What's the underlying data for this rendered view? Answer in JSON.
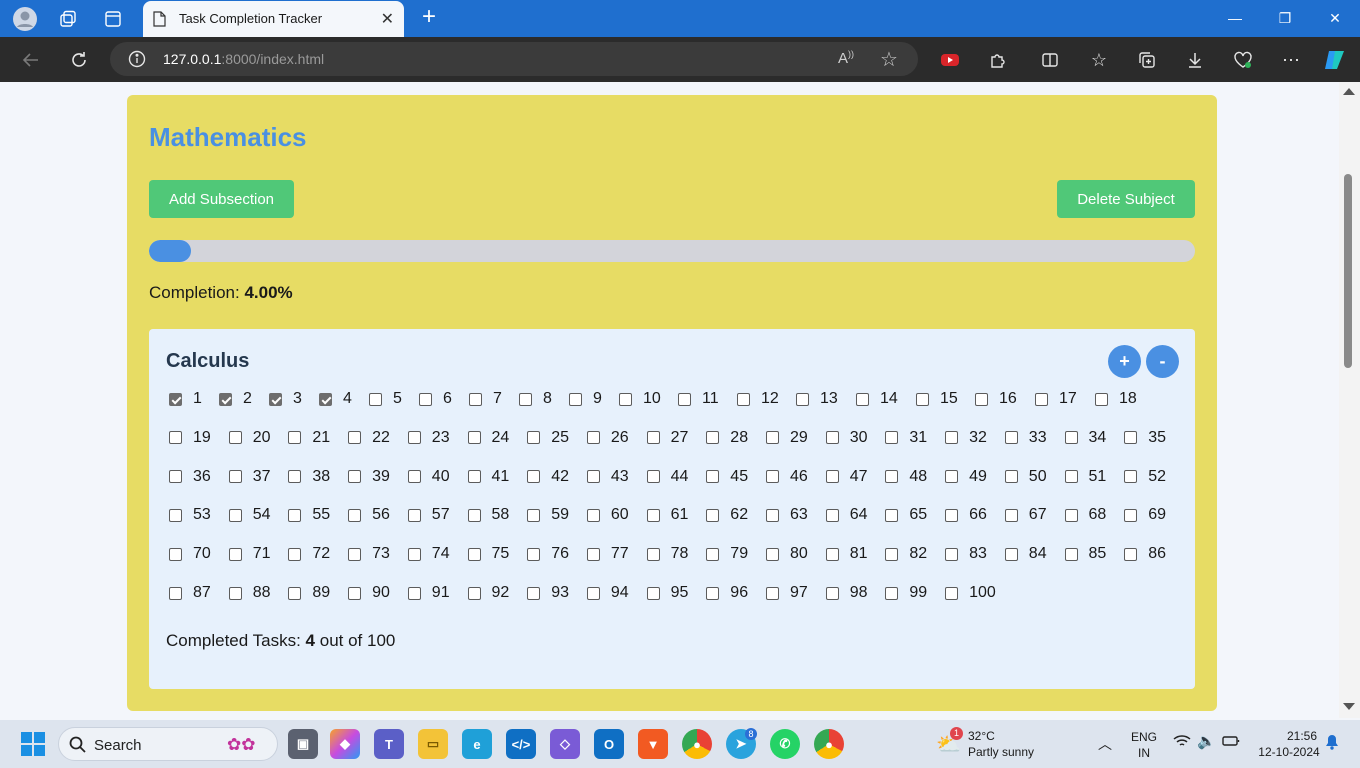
{
  "browser": {
    "tab_title": "Task Completion Tracker",
    "url_host": "127.0.0.1",
    "url_rest": ":8000/index.html"
  },
  "subject": {
    "title": "Mathematics",
    "add_subsection_label": "Add Subsection",
    "delete_subject_label": "Delete Subject",
    "progress_fraction": 0.04,
    "completion_label": "Completion:",
    "completion_value": "4.00%"
  },
  "subsection": {
    "title": "Calculus",
    "add_label": "+",
    "remove_label": "-",
    "task_count": 100,
    "checked_tasks": [
      1,
      2,
      3,
      4
    ],
    "completed_label": "Completed Tasks:",
    "completed_value": "4",
    "completed_suffix": "out of 100"
  },
  "taskbar": {
    "search_label": "Search",
    "weather_temp": "32°C",
    "weather_desc": "Partly sunny",
    "lang_1": "ENG",
    "lang_2": "IN",
    "time": "21:56",
    "date": "12-10-2024",
    "weather_badge": "1",
    "telegram_badge": "8"
  },
  "colors": {
    "subject_bg": "#e7dc64",
    "accent_blue": "#4a90e2",
    "button_green": "#50c878",
    "subsection_bg": "#e7f1fc"
  }
}
